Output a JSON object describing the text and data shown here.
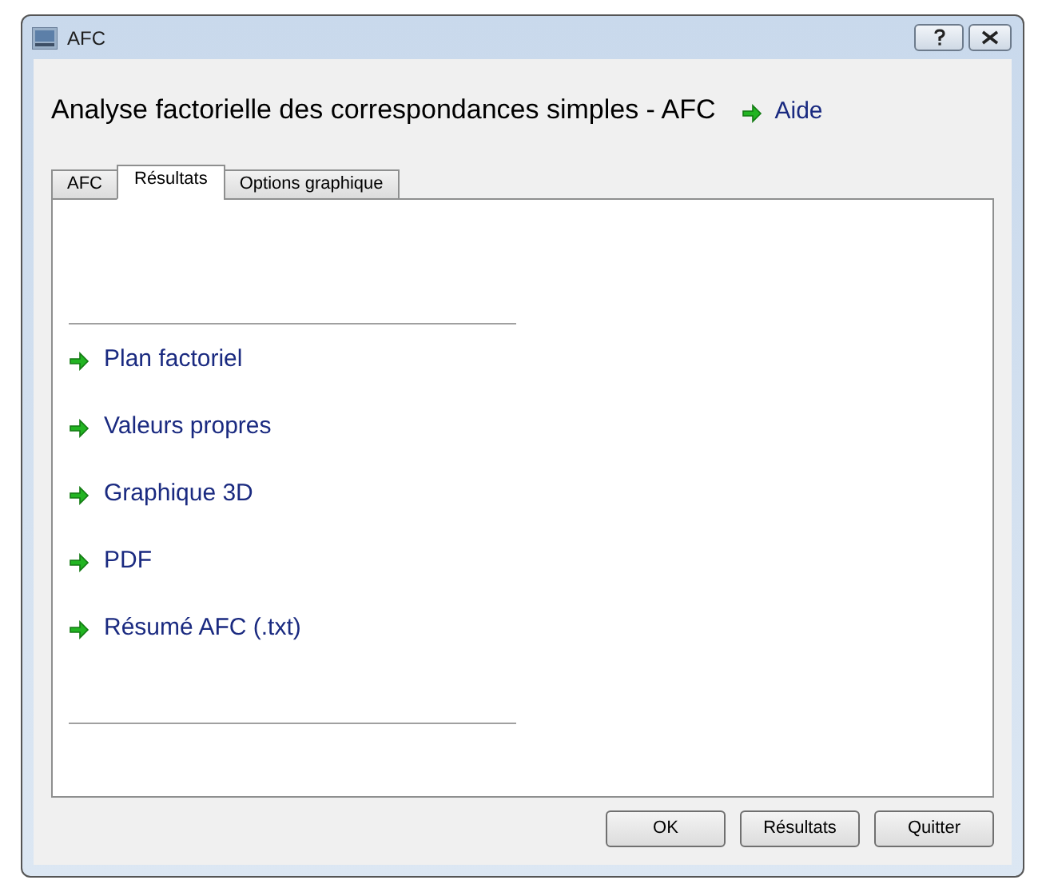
{
  "window": {
    "title": "AFC"
  },
  "heading": "Analyse factorielle des correspondances simples - AFC",
  "help_link": "Aide",
  "tabs": [
    {
      "label": "AFC",
      "selected": false
    },
    {
      "label": "Résultats",
      "selected": true
    },
    {
      "label": "Options graphique",
      "selected": false
    }
  ],
  "links": [
    "Plan factoriel",
    "Valeurs propres",
    "Graphique 3D",
    "PDF",
    "Résumé AFC (.txt)"
  ],
  "buttons": [
    "OK",
    "Résultats",
    "Quitter"
  ]
}
